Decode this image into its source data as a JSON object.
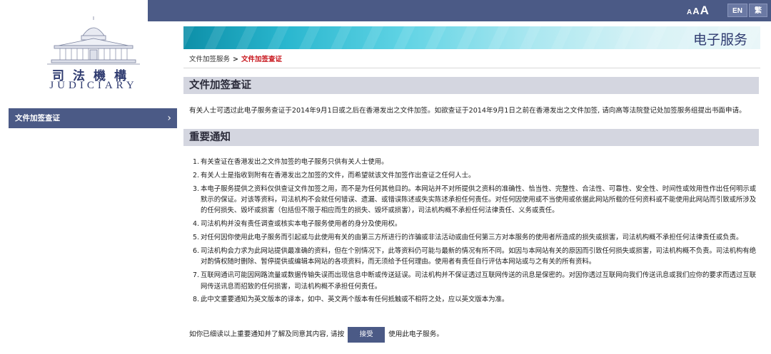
{
  "header": {
    "font_size_small": "A",
    "font_size_medium": "A",
    "font_size_large": "A",
    "lang_en": "EN",
    "lang_tc": "繁"
  },
  "logo": {
    "title": "司法機構",
    "subtitle": "JUDICIARY"
  },
  "sidebar": {
    "items": [
      {
        "label": "文件加签查证",
        "icon": "chevron-right-icon"
      }
    ]
  },
  "banner": {
    "title": "电子服务"
  },
  "breadcrumb": {
    "parent": "文件加签服务",
    "separator": ">",
    "current": "文件加签查证"
  },
  "main": {
    "heading": "文件加签查证",
    "intro": "有关人士可透过此电子服务查证于2014年9月1日或之后在香港发出之文件加签。如欲查证于2014年9月1日之前在香港发出之文件加签, 请向高等法院登记处加签服务组提出书面申请。",
    "notice_heading": "重要通知",
    "notices": [
      {
        "num": "1.",
        "text": "有关查证在香港发出之文件加签的电子服务只供有关人士使用。"
      },
      {
        "num": "2.",
        "text": "有关人士是指收到附有在香港发出之加签的文件，而希望就该文件加签作出查证之任何人士。"
      },
      {
        "num": "3.",
        "text": "本电子服务提供之资料仅供查证文件加签之用，而不是为任何其他目的。本网站并不对所提供之资料的准确性、恰当性、完整性、合法性、可靠性、安全性、时间性或效用性作出任何明示或默示的保证。对该等资料，司法机构不会就任何错误、遗漏、或错误陈述或失实陈述承担任何责任。对任何因使用或不当使用或依据此网站所载的任何资料或不能使用此网站而引致或所涉及的任何损失、毁坏或损害（包括但不限于相应而生的损失、毁坏或损害），司法机构概不承担任何法律责任、义务或责任。"
      },
      {
        "num": "4.",
        "text": "司法机构并没有责任调查或核实本电子服务使用者的身分及使用权。"
      },
      {
        "num": "5.",
        "text": "对任何因你使用此电子服务而引起或与此使用有关的由第三方所进行的诈骗或非法活动或由任何第三方对本服务的使用者所造成的损失或损害，司法机构概不承担任何法律责任或负责。"
      },
      {
        "num": "6.",
        "text": "司法机构会力求为此网站提供最准确的资料，但在个别情况下，此等资料仍可能与最新的情况有所不同。如因与本网站有关的原因而引致任何损失或损害，司法机构概不负责。司法机构有绝对酌情权随时删除、暂停提供或编辑本网站的各项资料，而无须给予任何理由。使用者有责任自行评估本网站或与之有关的所有资料。"
      },
      {
        "num": "7.",
        "text": "互联网通讯可能因网路流量或数据传输失误而出现信息中断或传送延误。司法机构并不保证透过互联网传送的讯息是保密的。对因你透过互联网向我们传送讯息或我们应你的要求而透过互联网传送讯息而招致的任何损害，司法机构概不承担任何责任。"
      },
      {
        "num": "8.",
        "text": "此中文重要通知为英文版本的译本，如中、英文两个版本有任何抵触或不相符之处，应以英文版本为准。"
      }
    ],
    "accept_prefix": "如你已细读以上重要通知并了解及同意其内容, 请按",
    "accept_button": "接受",
    "accept_suffix": "使用此电子服务。"
  }
}
